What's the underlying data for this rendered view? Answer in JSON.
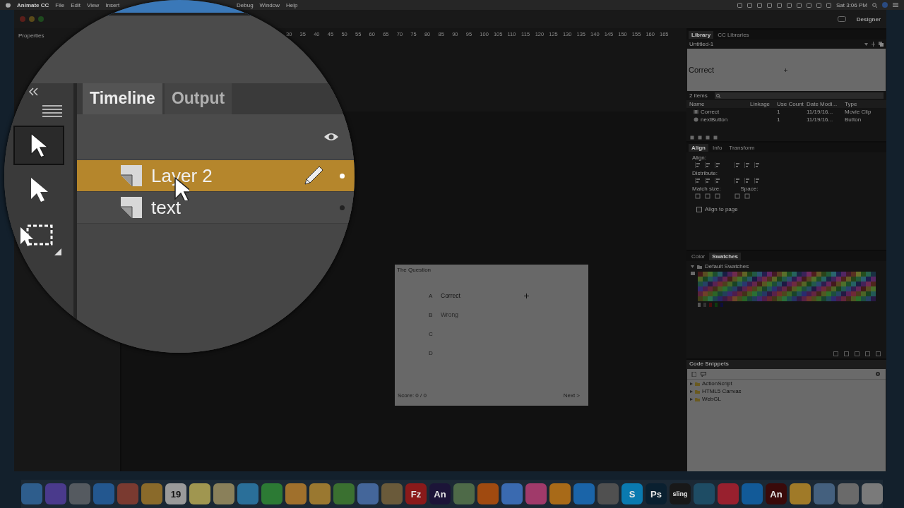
{
  "menu_bar": {
    "app_name": "Animate CC",
    "menus_left": [
      "File",
      "Edit",
      "View",
      "Insert"
    ],
    "menus_right": [
      "Debug",
      "Window",
      "Help"
    ],
    "clock": "Sat 3:06 PM"
  },
  "window": {
    "workspace": "Designer"
  },
  "properties": {
    "title": "Properties"
  },
  "timeline_ruler": {
    "frames": [
      "30",
      "35",
      "40",
      "45",
      "50",
      "55",
      "60",
      "65",
      "70",
      "75",
      "80",
      "85",
      "90",
      "95",
      "100",
      "105",
      "110",
      "115",
      "120",
      "125",
      "130",
      "135",
      "140",
      "145",
      "150",
      "155",
      "160",
      "165"
    ]
  },
  "stage": {
    "title": "The Question",
    "options": [
      {
        "letter": "A",
        "text": "Correct"
      },
      {
        "letter": "B",
        "text": "Wrong"
      },
      {
        "letter": "C"
      },
      {
        "letter": "D"
      }
    ],
    "score": "Score: 0 / 0",
    "next": "Next >"
  },
  "library": {
    "tabs": [
      {
        "label": "Library",
        "selected": true
      },
      {
        "label": "CC Libraries",
        "selected": false
      }
    ],
    "document": "Untitled-1",
    "preview": "Correct",
    "count": "2 items",
    "columns": [
      "Name",
      "Linkage",
      "Use Count",
      "Date Modi...",
      "Type"
    ],
    "rows": [
      {
        "kind": "movie_clip",
        "name": "Correct",
        "use_count": "1",
        "date": "11/19/16...",
        "type": "Movie Clip"
      },
      {
        "kind": "button",
        "name": "nextButton",
        "use_count": "1",
        "date": "11/19/16...",
        "type": "Button"
      }
    ]
  },
  "align": {
    "tabs": [
      {
        "label": "Align",
        "selected": true
      },
      {
        "label": "Info",
        "selected": false
      },
      {
        "label": "Transform",
        "selected": false
      }
    ],
    "align_label": "Align:",
    "distribute_label": "Distribute:",
    "match_size_label": "Match size:",
    "space_label": "Space:",
    "align_to_page": {
      "label": "Align to page",
      "checked": false
    }
  },
  "swatches": {
    "tabs": [
      {
        "label": "Color",
        "selected": false
      },
      {
        "label": "Swatches",
        "selected": true
      }
    ],
    "group": "Default Swatches"
  },
  "code_snippets": {
    "title": "Code Snippets",
    "folders": [
      "ActionScript",
      "HTML5 Canvas",
      "WebGL"
    ]
  },
  "magnifier": {
    "tabs": [
      {
        "label": "Timeline",
        "selected": true
      },
      {
        "label": "Output",
        "selected": false
      }
    ],
    "layers": [
      {
        "name": "Layer 2",
        "selected": true,
        "editing": true
      },
      {
        "name": "text",
        "selected": false,
        "editing": false
      }
    ]
  },
  "dock": {
    "apps": [
      {
        "color": "#2e5d8c"
      },
      {
        "color": "#4a3a8c"
      },
      {
        "color": "#555a60"
      },
      {
        "color": "#23578f"
      },
      {
        "color": "#7a3a30"
      },
      {
        "color": "#8a6a2a"
      },
      {
        "color": "#9a9a9a",
        "label": "19"
      },
      {
        "color": "#a09650"
      },
      {
        "color": "#8a805a"
      },
      {
        "color": "#2a6f99"
      },
      {
        "color": "#2c7a34"
      },
      {
        "color": "#a0702c"
      },
      {
        "color": "#9a7830"
      },
      {
        "color": "#3a7030"
      },
      {
        "color": "#44669a"
      },
      {
        "color": "#6a5a3a"
      },
      {
        "color": "#8a1a1a",
        "label": "Fz"
      },
      {
        "color": "#1c1438",
        "label": "An"
      },
      {
        "color": "#4e6a48"
      },
      {
        "color": "#a04a10"
      },
      {
        "color": "#3a6ab0"
      },
      {
        "color": "#a03a6a"
      },
      {
        "color": "#a86a18"
      },
      {
        "color": "#1a64a8"
      },
      {
        "color": "#505050"
      },
      {
        "color": "#0a7ab0",
        "label": "S"
      },
      {
        "color": "#0a2030",
        "label": "Ps"
      },
      {
        "color": "#181818",
        "label": "sling"
      },
      {
        "color": "#1e4c64"
      },
      {
        "color": "#98202e"
      },
      {
        "color": "#125a98"
      },
      {
        "color": "#3a0a0a",
        "label": "An"
      },
      {
        "color": "#a07a28"
      },
      {
        "color": "#44607e"
      },
      {
        "color": "#6a6a6a"
      },
      {
        "color": "#7a7a7a"
      }
    ]
  }
}
